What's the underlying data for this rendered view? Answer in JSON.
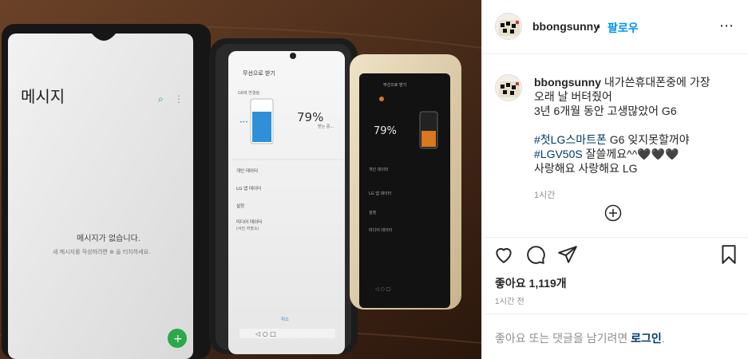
{
  "post": {
    "username": "bbongsunny",
    "separator": "•",
    "follow_label": "팔로우",
    "more_icon": "⋯",
    "avatar_icon": "profile-avatar-icon"
  },
  "photo": {
    "messages_title": "메시지",
    "empty_message": "메시지가 없습니다.",
    "empty_hint": "새 메시지를 작성하려면 ⊕ 을 터치하세요.",
    "charging_title": "무선으로 받기",
    "charging_status": "G6에 연결됨",
    "battery_percent": "79%",
    "battery_note": "받는 중...",
    "menu_items": [
      "개인 데이터",
      "LG 앱 데이터",
      "설정",
      "미디어 데이터",
      "(사진 저장소)"
    ],
    "dots_label": "•••",
    "bottom_label": "취소"
  },
  "caption": {
    "username": "bbongsunny",
    "line1": "내가쓴휴대폰중에 가장",
    "line2": "오래 날 버텨줬어",
    "line3": "3년 6개월 동안 고생많았어 G6",
    "tag1": "#첫LG스마트폰",
    "line4_rest": " G6 잊지못할꺼야",
    "tag2": "#LGV50S",
    "line5_rest": " 잘쓸께요^^🖤🖤🖤",
    "line6": "사랑해요 사랑해요 LG",
    "time": "1시간"
  },
  "stats": {
    "likes": "좋아요 1,119개",
    "posted": "1시간 전"
  },
  "comment_bar": {
    "prompt": "좋아요 또는 댓글을 남기려면 ",
    "login": "로그인",
    "suffix": "."
  },
  "icons": {
    "load_more": "plus-circle-icon",
    "like": "heart-icon",
    "comment": "comment-icon",
    "share": "share-icon",
    "save": "bookmark-icon"
  },
  "colors": {
    "link_blue": "#0095f6",
    "hashtag": "#00376b",
    "muted": "#8e8e8e",
    "text": "#262626"
  }
}
